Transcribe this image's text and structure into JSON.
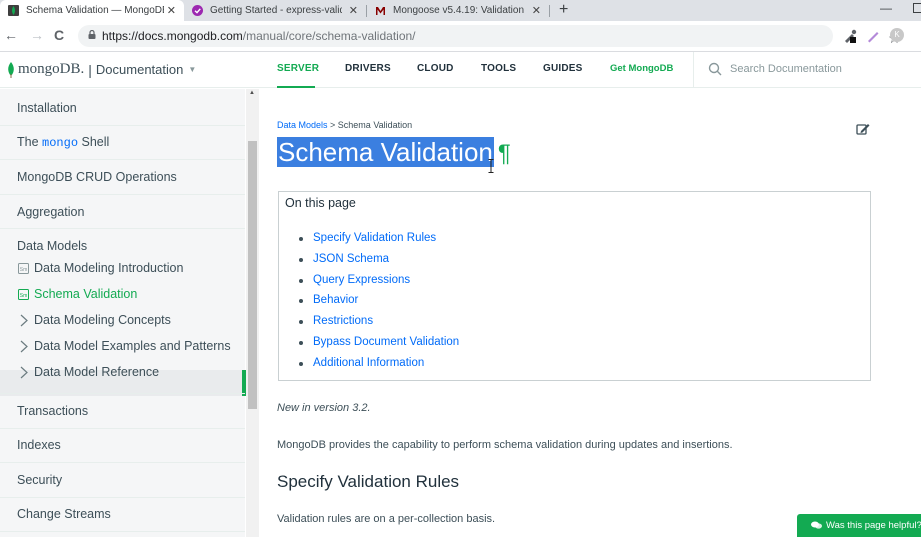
{
  "browser": {
    "tabs": [
      {
        "title": "Schema Validation — MongoDB",
        "favicon": "mongodb-leaf-icon",
        "active": true
      },
      {
        "title": "Getting Started - express-validator",
        "favicon": "express-validator-icon",
        "active": false
      },
      {
        "title": "Mongoose v5.4.19: Validation",
        "favicon": "mongoose-icon",
        "active": false
      }
    ],
    "new_tab_glyph": "+",
    "close_glyph": "✕",
    "minimize_glyph": "—",
    "back_glyph": "←",
    "forward_glyph": "→",
    "reload_glyph": "C",
    "url_host": "https://docs.mongodb.com",
    "url_path": "/manual/core/schema-validation/",
    "star_glyph": "☆",
    "extension_badge": "K"
  },
  "site": {
    "brand": "mongoDB.",
    "section": "Documentation",
    "caret": "▼",
    "nav": [
      {
        "label": "SERVER",
        "active": true
      },
      {
        "label": "DRIVERS",
        "active": false
      },
      {
        "label": "CLOUD",
        "active": false
      },
      {
        "label": "TOOLS",
        "active": false
      },
      {
        "label": "GUIDES",
        "active": false
      }
    ],
    "get_mongodb": "Get MongoDB",
    "search_placeholder": "Search Documentation"
  },
  "sidebar": {
    "installation": "Installation",
    "shell_pre": "The ",
    "shell_code": "mongo",
    "shell_post": " Shell",
    "crud": "MongoDB CRUD Operations",
    "aggregation": "Aggregation",
    "data_models": "Data Models",
    "data_modeling_intro": "Data Modeling Introduction",
    "schema_validation": "Schema Validation",
    "data_modeling_concepts": "Data Modeling Concepts",
    "data_model_examples": "Data Model Examples and Patterns",
    "data_model_reference": "Data Model Reference",
    "transactions": "Transactions",
    "indexes": "Indexes",
    "security": "Security",
    "change_streams": "Change Streams"
  },
  "main": {
    "breadcrumb_parent": "Data Models",
    "breadcrumb_sep": " > ",
    "breadcrumb_current": "Schema Validation",
    "title": "Schema Validation",
    "pilcrow": "¶",
    "on_this_page": "On this page",
    "toc": [
      "Specify Validation Rules",
      "JSON Schema",
      "Query Expressions",
      "Behavior",
      "Restrictions",
      "Bypass Document Validation",
      "Additional Information"
    ],
    "new_in": "New in version 3.2.",
    "intro": "MongoDB provides the capability to perform schema validation during updates and insertions.",
    "h2": "Specify Validation Rules",
    "rules_para": "Validation rules are on a per-collection basis.",
    "feedback": "Was this page helpful?"
  },
  "colors": {
    "accent_green": "#13aa52",
    "link_blue": "#016bf8",
    "selection_blue": "#3b7fe0"
  }
}
